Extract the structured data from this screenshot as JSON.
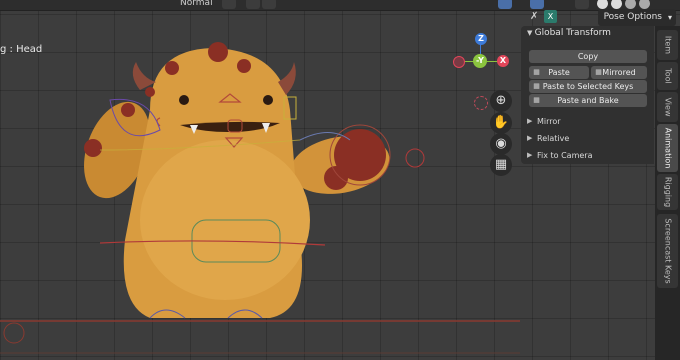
{
  "viewport": {
    "active_bone_label": "g : Head",
    "shading_mode": "Normal"
  },
  "header": {
    "mode_icon": "x-axis-icon",
    "pose_options_label": "Pose Options"
  },
  "gizmo": {
    "z_label": "Z",
    "y_label": "-Y",
    "x_label": "X"
  },
  "nav_buttons": [
    "zoom-icon",
    "hand-icon",
    "camera-icon",
    "grid-icon"
  ],
  "npanel": {
    "section_title": "Global Transform",
    "copy_label": "Copy",
    "paste_label": "Paste",
    "mirrored_label": "Mirrored",
    "paste_selected_label": "Paste to Selected Keys",
    "paste_bake_label": "Paste and Bake",
    "subsections": [
      "Mirror",
      "Relative",
      "Fix to Camera"
    ]
  },
  "tabs": [
    "Item",
    "Tool",
    "View",
    "Animation",
    "Rigging",
    "Screencast Keys"
  ],
  "active_tab": "Animation",
  "colors": {
    "viewport_bg": "#3d3d3d",
    "panel_bg": "#303030",
    "button_bg": "#545454",
    "character_body": "#d79a3c",
    "character_spots": "#8a2f24",
    "axis_x": "#e2465a",
    "axis_y": "#8bc43f",
    "axis_z": "#3d7bd9"
  }
}
